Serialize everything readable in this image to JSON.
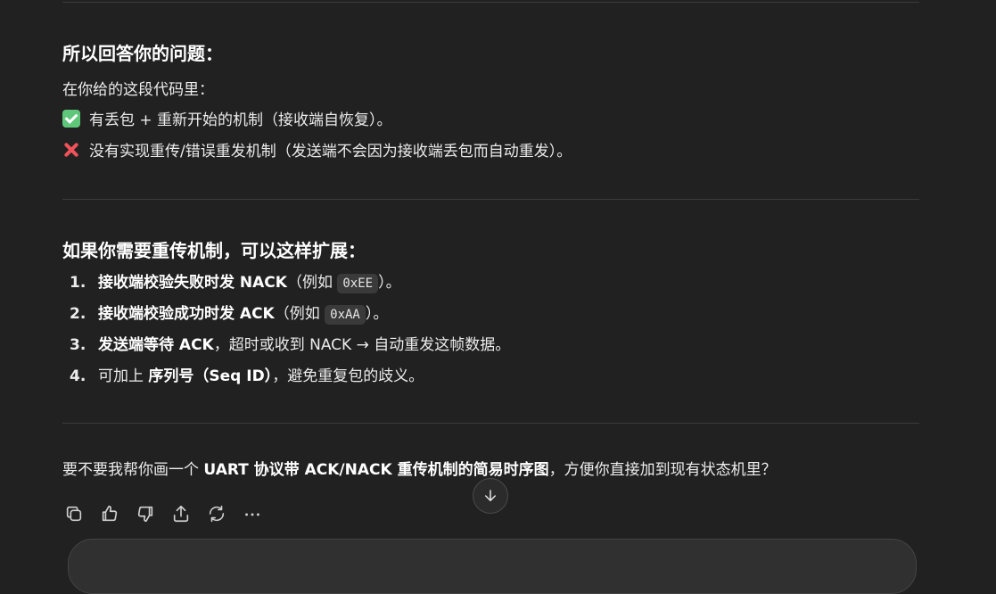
{
  "section1": {
    "heading": "所以回答你的问题：",
    "intro": "在你给的这段代码里：",
    "yes_line": "有丢包 + 重新开始的机制（接收端自恢复）。",
    "no_line": "没有实现重传/错误重发机制（发送端不会因为接收端丢包而自动重发）。",
    "yes_icon": "check-mark-emoji",
    "no_icon": "cross-mark-emoji"
  },
  "section2": {
    "heading": "如果你需要重传机制，可以这样扩展：",
    "items": [
      {
        "num": "1.",
        "bold": "接收端校验失败时发 NACK",
        "pre": "（例如 ",
        "code": "0xEE",
        "post": "）。"
      },
      {
        "num": "2.",
        "bold": "接收端校验成功时发 ACK",
        "pre": "（例如 ",
        "code": "0xAA",
        "post": "）。"
      },
      {
        "num": "3.",
        "bold": "发送端等待 ACK",
        "rest": "，超时或收到 NACK → 自动重发这帧数据。"
      },
      {
        "num": "4.",
        "pre": "可加上 ",
        "bold": "序列号（Seq ID）",
        "rest": "，避免重复包的歧义。"
      }
    ]
  },
  "closing": {
    "pre": "要不要我帮你画一个 ",
    "bold": "UART 协议带 ACK/NACK 重传机制的简易时序图",
    "post": "，方便你直接加到现有状态机里？"
  },
  "actions": [
    "copy-icon",
    "thumbs-up-icon",
    "thumbs-down-icon",
    "share-icon",
    "regenerate-icon",
    "more-icon"
  ],
  "colors": {
    "background": "#212121",
    "text": "#ececec",
    "check": "#5fc77a",
    "cross": "#f0525a"
  }
}
